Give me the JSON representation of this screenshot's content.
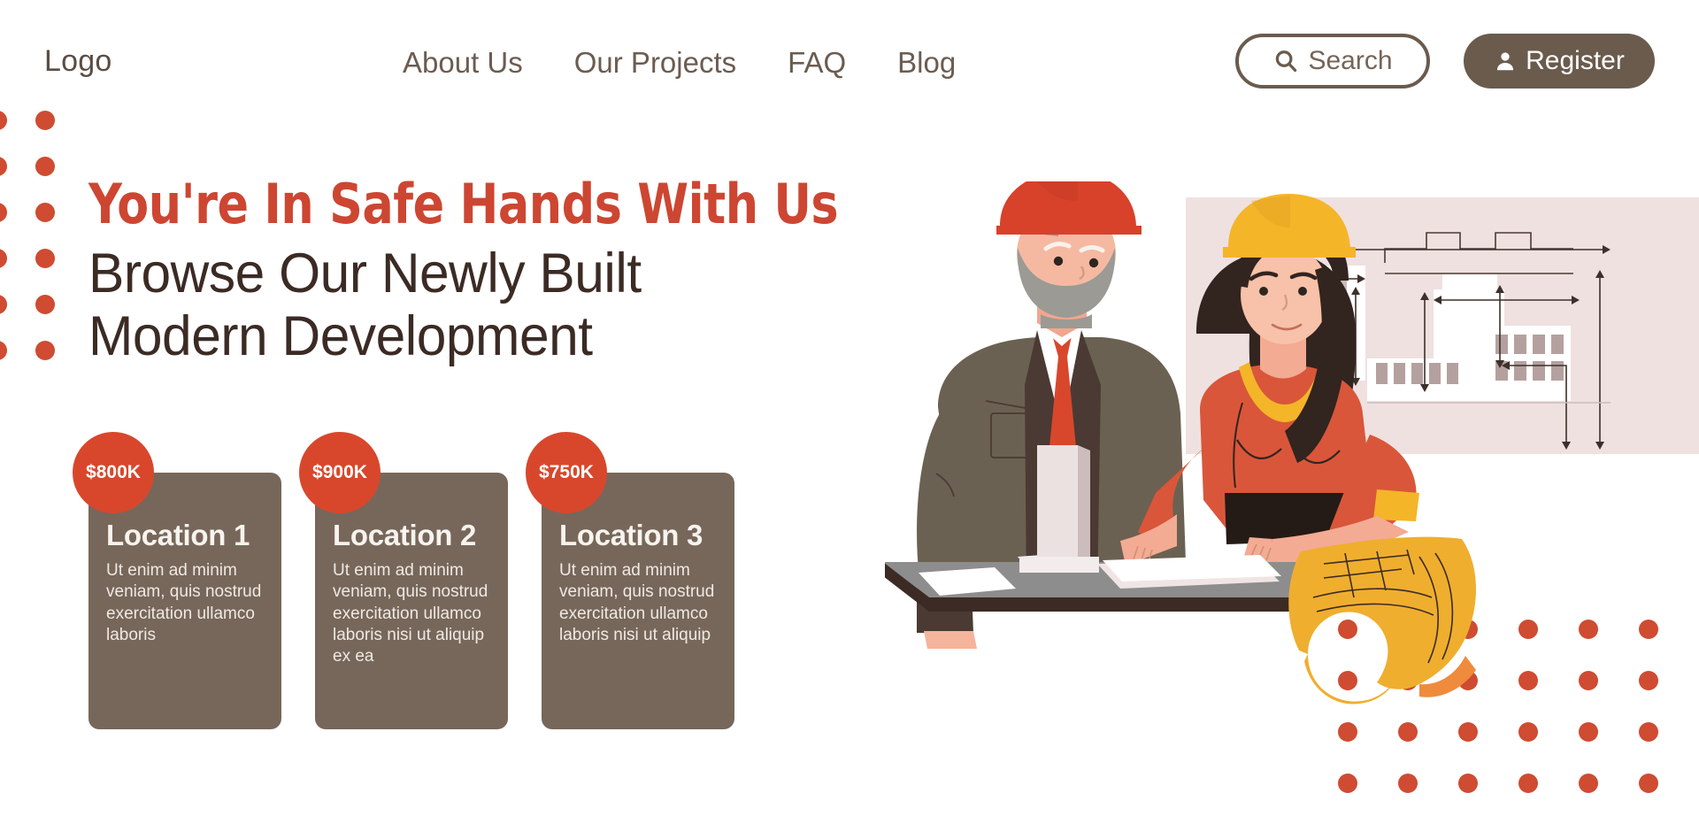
{
  "header": {
    "logo": "Logo",
    "nav": [
      {
        "label": "About Us"
      },
      {
        "label": "Our Projects"
      },
      {
        "label": "FAQ"
      },
      {
        "label": "Blog"
      }
    ],
    "search": {
      "label": "Search",
      "icon": "search-icon"
    },
    "register": {
      "label": "Register",
      "icon": "user-icon"
    }
  },
  "hero": {
    "headline": "You're In Safe Hands With Us",
    "subline_line1": "Browse Our Newly Built",
    "subline_line2": "Modern Development"
  },
  "cards": [
    {
      "price": "$800K",
      "title": "Location 1",
      "body": "Ut enim ad minim veniam, quis nostrud exercitation ullamco laboris"
    },
    {
      "price": "$900K",
      "title": "Location 2",
      "body": "Ut enim ad minim veniam, quis nostrud exercitation ullamco laboris nisi ut aliquip ex ea"
    },
    {
      "price": "$750K",
      "title": "Location 3",
      "body": "Ut enim ad minim veniam, quis nostrud exercitation ullamco laboris nisi ut aliquip"
    }
  ],
  "decor": {
    "dots_left": {
      "rows": 6,
      "cols": 2,
      "color": "#cf4b31"
    },
    "dots_right": {
      "rows": 4,
      "cols": 6,
      "color": "#cf4b31"
    }
  },
  "illustration": {
    "alt": "Two architects in hard hats reviewing a building model and blueprint",
    "figures": [
      "senior-architect-red-helmet",
      "female-engineer-yellow-helmet"
    ],
    "objects": [
      "blueprint-wall-panel",
      "model-table",
      "rolled-blueprint",
      "building-model"
    ]
  },
  "colors": {
    "accent_red": "#cd4632",
    "badge_red": "#d8472c",
    "card_brown": "#77675a",
    "text_brown": "#6b5c51",
    "heading_dark": "#3b2b24",
    "blueprint_bg": "#efe1e0",
    "helmet_yellow": "#f4b529",
    "scroll_yellow": "#efae2e"
  }
}
